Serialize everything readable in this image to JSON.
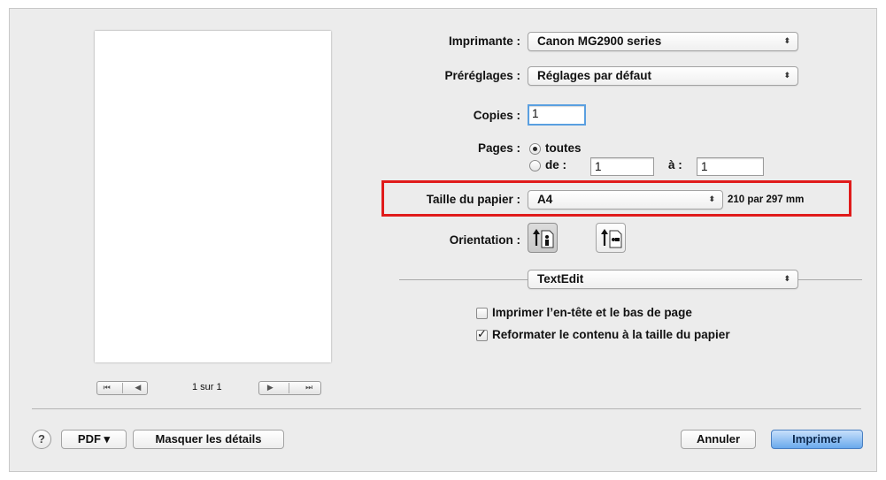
{
  "preview": {
    "page_counter": "1 sur 1",
    "first_page_icon": "⏮",
    "prev_page_icon": "◀",
    "next_page_icon": "▶",
    "last_page_icon": "⏭"
  },
  "printer": {
    "label": "Imprimante :",
    "value": "Canon MG2900 series"
  },
  "presets": {
    "label": "Préréglages :",
    "value": "Réglages par défaut"
  },
  "copies": {
    "label": "Copies :",
    "value": "1"
  },
  "pages": {
    "label": "Pages :",
    "all_label": "toutes",
    "all_selected": true,
    "range_label": "de :",
    "from_value": "1",
    "to_label": "à :",
    "to_value": "1"
  },
  "paper_size": {
    "label": "Taille du papier :",
    "value": "A4",
    "dimensions": "210 par 297 mm"
  },
  "orientation": {
    "label": "Orientation :",
    "selected": "portrait"
  },
  "app_section": {
    "value": "TextEdit"
  },
  "options": {
    "header_footer": {
      "label": "Imprimer l’en-tête et le bas de page",
      "checked": false
    },
    "rewrap": {
      "label": "Reformater le contenu à la taille du papier",
      "checked": true
    }
  },
  "footer": {
    "help_label": "?",
    "pdf_label": "PDF ▾",
    "hide_details_label": "Masquer les détails",
    "cancel_label": "Annuler",
    "print_label": "Imprimer"
  },
  "colors": {
    "highlight": "#e01b1b",
    "default_button": "#6aa9ec",
    "dialog_bg": "#ececec"
  }
}
